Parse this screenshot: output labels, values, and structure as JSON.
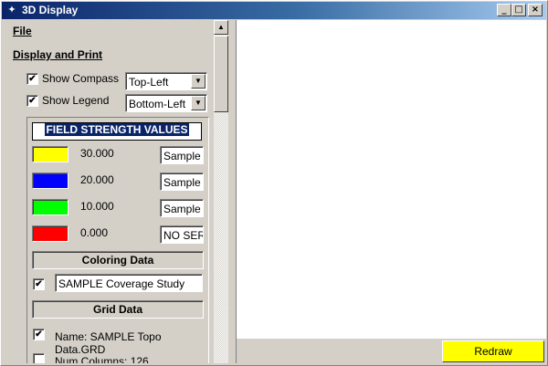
{
  "window": {
    "title": "3D Display",
    "icon": "compass-icon",
    "minimize": "_",
    "maximize": "□",
    "close": "×"
  },
  "menu": {
    "file": "File",
    "section": "Display and Print"
  },
  "options": {
    "show_compass": {
      "label": "Show Compass",
      "checked": true,
      "value": "Top-Left"
    },
    "show_legend": {
      "label": "Show Legend",
      "checked": true,
      "value": "Bottom-Left"
    }
  },
  "field_strength": {
    "title": "FIELD STRENGTH VALUES",
    "rows": [
      {
        "color": "#ffff00",
        "value": "30.000",
        "label": "Sample"
      },
      {
        "color": "#0000ff",
        "value": "20.000",
        "label": "Sample"
      },
      {
        "color": "#00ff00",
        "value": "10.000",
        "label": "Sample"
      },
      {
        "color": "#ff0000",
        "value": "0.000",
        "label": "NO SER"
      }
    ]
  },
  "coloring": {
    "header": "Coloring Data",
    "checked": true,
    "value": "SAMPLE Coverage Study"
  },
  "grid": {
    "header": "Grid Data",
    "name": {
      "checked": true,
      "label": "Name: SAMPLE Topo Data.GRD"
    },
    "columns": {
      "checked": false,
      "label": "Num Columns: 126"
    }
  },
  "buttons": {
    "redraw": "Redraw"
  },
  "check_mark": "✔"
}
